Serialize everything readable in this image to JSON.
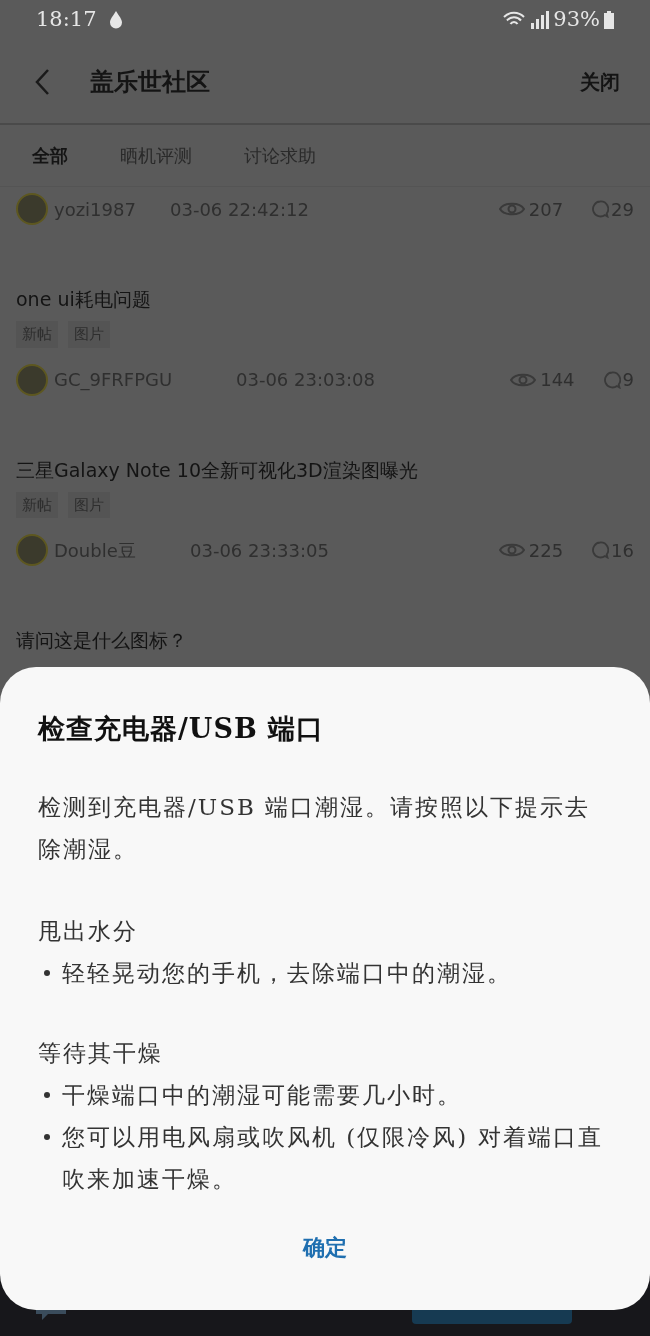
{
  "status_bar": {
    "time": "18:17",
    "battery": "93%"
  },
  "header": {
    "title": "盖乐世社区",
    "close": "关闭"
  },
  "tabs": [
    {
      "label": "全部",
      "selected": true
    },
    {
      "label": "晒机评测",
      "selected": false
    },
    {
      "label": "讨论求助",
      "selected": false
    }
  ],
  "posts": [
    {
      "user": "yozi1987",
      "time": "03-06 22:42:12",
      "views": "207",
      "comments": "29"
    },
    {
      "title": "one ui耗电问题",
      "tags": [
        "新帖",
        "图片"
      ],
      "user": "GC_9FRFPGU",
      "time": "03-06 23:03:08",
      "views": "144",
      "comments": "9"
    },
    {
      "title": "三星Galaxy Note 10全新可视化3D渲染图曝光",
      "tags": [
        "新帖",
        "图片"
      ],
      "user": "Double豆",
      "time": "03-06 23:33:05",
      "views": "225",
      "comments": "16"
    },
    {
      "title": "请问这是什么图标？"
    }
  ],
  "dialog": {
    "title": "检查充电器/USB 端口",
    "blocks": [
      {
        "kind": "paragraph",
        "text": "检测到充电器/USB 端口潮湿。请按照以下提示去除潮湿。"
      },
      {
        "kind": "heading",
        "text": "甩出水分"
      },
      {
        "kind": "bullet",
        "text": "轻轻晃动您的手机，去除端口中的潮湿。"
      },
      {
        "kind": "heading",
        "text": "等待其干燥"
      },
      {
        "kind": "bullet",
        "text": "干燥端口中的潮湿可能需要几小时。"
      },
      {
        "kind": "bullet",
        "text": "您可以用电风扇或吹风机 (仅限冷风) 对着端口直吹来加速干燥。"
      }
    ],
    "button": "确定"
  }
}
